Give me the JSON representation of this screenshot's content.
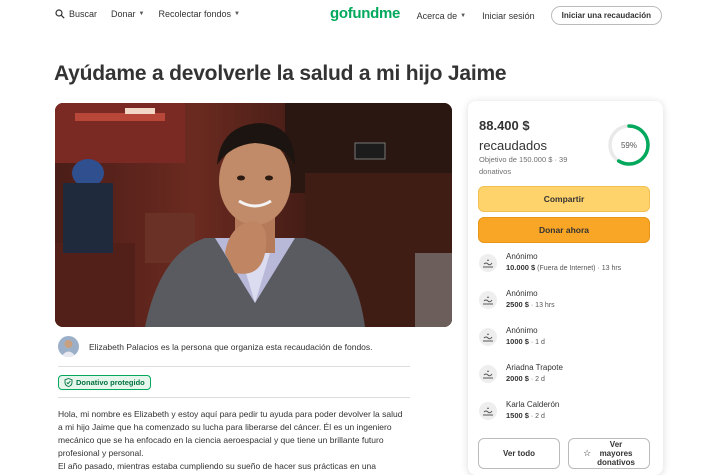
{
  "header": {
    "search": "Buscar",
    "donate": "Donar",
    "fundraise": "Recolectar fondos",
    "logo": "gofundme",
    "about": "Acerca de",
    "signin": "Iniciar sesión",
    "start": "Iniciar una recaudación"
  },
  "page_title": "Ayúdame a devolverle la salud a mi hijo Jaime",
  "organizer": "Elizabeth Palacios es la persona que organiza esta recaudación de fondos.",
  "badge": "Donativo protegido",
  "story": [
    "Hola, mi nombre es Elizabeth y estoy aquí para pedir tu ayuda para poder devolver la salud",
    "a mi hijo Jaime que ha comenzado su lucha para liberarse del cáncer. Él es un ingeniero",
    "mecánico que se ha enfocado en la ciencia aeroespacial y que tiene un brillante futuro",
    "profesional y personal.",
    "El año pasado, mientras estaba cumpliendo su sueño de hacer sus prácticas en una"
  ],
  "campaign": {
    "raised": "88.400 $",
    "raised_label": "recaudados",
    "goal_text": "Objetivo de 150.000 $ · 39 donativos",
    "percent_label": "59%",
    "percent": 0.59,
    "share": "Compartir",
    "donate_now": "Donar ahora",
    "see_all": "Ver todo",
    "see_top_line1": "Ver",
    "see_top_line2": "mayores",
    "see_top_line3": "donativos"
  },
  "donations": [
    {
      "name": "Anónimo",
      "amount": "10.000 $",
      "detail": " (Fuera de Internet) · 13 hrs"
    },
    {
      "name": "Anónimo",
      "amount": "2500 $",
      "detail": " · 13 hrs"
    },
    {
      "name": "Anónimo",
      "amount": "1000 $",
      "detail": " · 1 d"
    },
    {
      "name": "Ariadna Trapote",
      "amount": "2000 $",
      "detail": " · 2 d"
    },
    {
      "name": "Karla Calderón",
      "amount": "1500 $",
      "detail": " · 2 d"
    }
  ],
  "colors": {
    "brand": "#02a95c",
    "share": "#ffd36b",
    "donate": "#f9a526"
  }
}
